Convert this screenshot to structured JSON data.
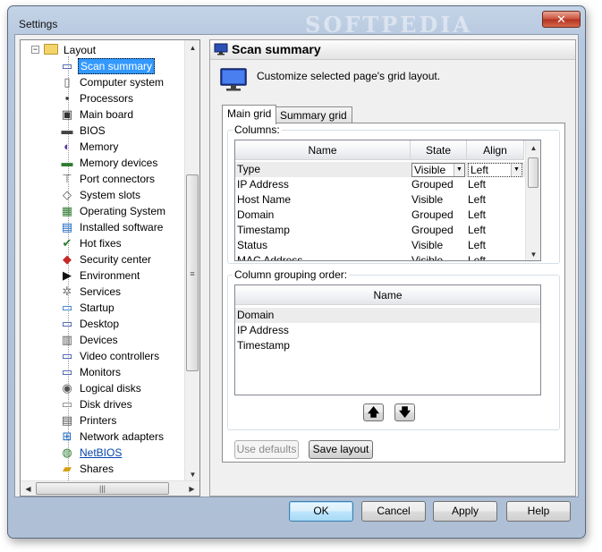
{
  "window": {
    "title": "Settings",
    "watermark": "SOFTPEDIA",
    "close_glyph": "✕"
  },
  "tree": {
    "parent_label": "Layout",
    "items": [
      {
        "label": "Scan summary",
        "icon": "monitor-icon",
        "glyph": "▭",
        "color": "#1b3f9c",
        "selected": true
      },
      {
        "label": "Computer system",
        "icon": "computer-icon",
        "glyph": "▯",
        "color": "#555"
      },
      {
        "label": "Processors",
        "icon": "cpu-icon",
        "glyph": "▪",
        "color": "#333"
      },
      {
        "label": "Main board",
        "icon": "motherboard-icon",
        "glyph": "▣",
        "color": "#333"
      },
      {
        "label": "BIOS",
        "icon": "chip-icon",
        "glyph": "▬",
        "color": "#444"
      },
      {
        "label": "Memory",
        "icon": "memory-icon",
        "glyph": "◐",
        "color": "#5a3aa0"
      },
      {
        "label": "Memory devices",
        "icon": "ram-icon",
        "glyph": "▬",
        "color": "#2e7d32"
      },
      {
        "label": "Port connectors",
        "icon": "connector-icon",
        "glyph": "⊤",
        "color": "#666"
      },
      {
        "label": "System slots",
        "icon": "slot-icon",
        "glyph": "◇",
        "color": "#555"
      },
      {
        "label": "Operating System",
        "icon": "os-icon",
        "glyph": "▦",
        "color": "#2e7d32"
      },
      {
        "label": "Installed software",
        "icon": "software-icon",
        "glyph": "▤",
        "color": "#1565c0"
      },
      {
        "label": "Hot fixes",
        "icon": "shield-icon",
        "glyph": "✔",
        "color": "#2e7d32"
      },
      {
        "label": "Security center",
        "icon": "security-shield-icon",
        "glyph": "◆",
        "color": "#c62828"
      },
      {
        "label": "Environment",
        "icon": "terminal-icon",
        "glyph": "▶",
        "color": "#111"
      },
      {
        "label": "Services",
        "icon": "gear-icon",
        "glyph": "✲",
        "color": "#777"
      },
      {
        "label": "Startup",
        "icon": "startup-icon",
        "glyph": "▭",
        "color": "#1565c0"
      },
      {
        "label": "Desktop",
        "icon": "desktop-icon",
        "glyph": "▭",
        "color": "#1b3f9c"
      },
      {
        "label": "Devices",
        "icon": "devices-icon",
        "glyph": "▥",
        "color": "#555"
      },
      {
        "label": "Video controllers",
        "icon": "video-icon",
        "glyph": "▭",
        "color": "#1b3f9c"
      },
      {
        "label": "Monitors",
        "icon": "monitor-icon",
        "glyph": "▭",
        "color": "#1b3f9c"
      },
      {
        "label": "Logical disks",
        "icon": "disk-icon",
        "glyph": "◉",
        "color": "#555"
      },
      {
        "label": "Disk drives",
        "icon": "drive-icon",
        "glyph": "▭",
        "color": "#777"
      },
      {
        "label": "Printers",
        "icon": "printer-icon",
        "glyph": "▤",
        "color": "#555"
      },
      {
        "label": "Network adapters",
        "icon": "network-icon",
        "glyph": "⊞",
        "color": "#1565c0"
      },
      {
        "label": "NetBIOS",
        "icon": "globe-icon",
        "glyph": "◍",
        "color": "#2e7d32",
        "link": true
      },
      {
        "label": "Shares",
        "icon": "folder-share-icon",
        "glyph": "▰",
        "color": "#d4a017"
      }
    ],
    "hscroll_grip": "|||",
    "vscroll_grip": "≡"
  },
  "panel": {
    "title": "Scan summary",
    "description": "Customize selected page's grid layout.",
    "tabs": [
      "Main grid",
      "Summary grid"
    ],
    "columns_group": {
      "label": "Columns:",
      "headers": [
        "Name",
        "State",
        "Align"
      ],
      "rows": [
        [
          "Type",
          "Visible",
          "Left"
        ],
        [
          "IP Address",
          "Grouped",
          "Left"
        ],
        [
          "Host Name",
          "Visible",
          "Left"
        ],
        [
          "Domain",
          "Grouped",
          "Left"
        ],
        [
          "Timestamp",
          "Grouped",
          "Left"
        ],
        [
          "Status",
          "Visible",
          "Left"
        ],
        [
          "MAC Address",
          "Visible",
          "Left"
        ]
      ]
    },
    "grouping_group": {
      "label": "Column grouping order:",
      "header": "Name",
      "rows": [
        "Domain",
        "IP Address",
        "Timestamp"
      ]
    },
    "move_up_glyph": "🡅",
    "move_down_glyph": "🡇",
    "use_defaults_label": "Use defaults",
    "save_layout_label": "Save layout"
  },
  "buttons": {
    "ok": "OK",
    "cancel": "Cancel",
    "apply": "Apply",
    "help": "Help"
  }
}
